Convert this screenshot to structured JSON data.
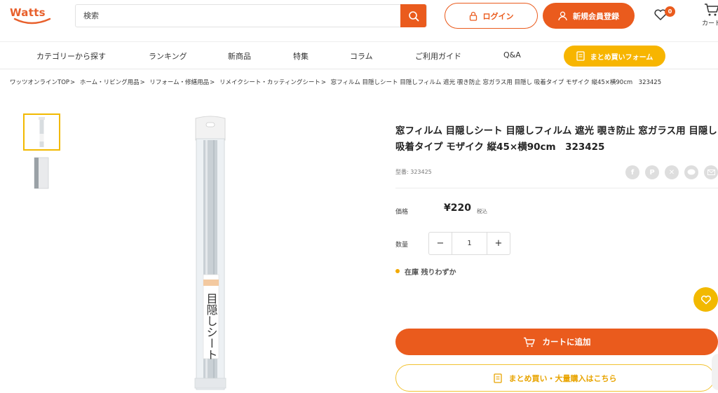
{
  "header": {
    "logo_text": "Watts",
    "search_placeholder": "検索",
    "login_label": "ログイン",
    "register_label": "新規会員登録",
    "favorites_count": "0",
    "cart_label": "カート"
  },
  "nav": {
    "items": [
      {
        "label": "カテゴリーから探す"
      },
      {
        "label": "ランキング"
      },
      {
        "label": "新商品"
      },
      {
        "label": "特集"
      },
      {
        "label": "コラム"
      },
      {
        "label": "ご利用ガイド"
      },
      {
        "label": "Q&A"
      }
    ],
    "bulk_order_label": "まとめ買いフォーム"
  },
  "breadcrumb": {
    "items": [
      {
        "label": "ワッツオンラインTOP"
      },
      {
        "label": "ホーム・リビング用品"
      },
      {
        "label": "リフォーム・修繕用品"
      },
      {
        "label": "リメイクシート・カッティングシート"
      }
    ],
    "separator": ">",
    "current": "窓フィルム 目隠しシート 目隠しフィルム 遮光 覗き防止 窓ガラス用 目隠し 吸着タイプ モザイク 縦45×横90cm　323425"
  },
  "product": {
    "title": "窓フィルム 目隠しシート 目隠しフィルム 遮光 覗き防止 窓ガラス用 目隠し 吸着タイプ モザイク 縦45×横90cm　323425",
    "sku": "型番: 323425",
    "package_text": "目隠しシート",
    "price_label": "価格",
    "price": "¥220",
    "tax_label": "税込",
    "qty_label": "数量",
    "qty_value": "1",
    "stock_text": "在庫 残りわずか",
    "add_to_cart_label": "カートに追加",
    "bulk_buy_label": "まとめ買い・大量購入はこちら",
    "share_icons": [
      "facebook-icon",
      "pinterest-icon",
      "x-icon",
      "line-icon",
      "mail-icon"
    ]
  },
  "colors": {
    "brand_orange": "#ea5b1d",
    "accent_yellow": "#f2b900"
  }
}
